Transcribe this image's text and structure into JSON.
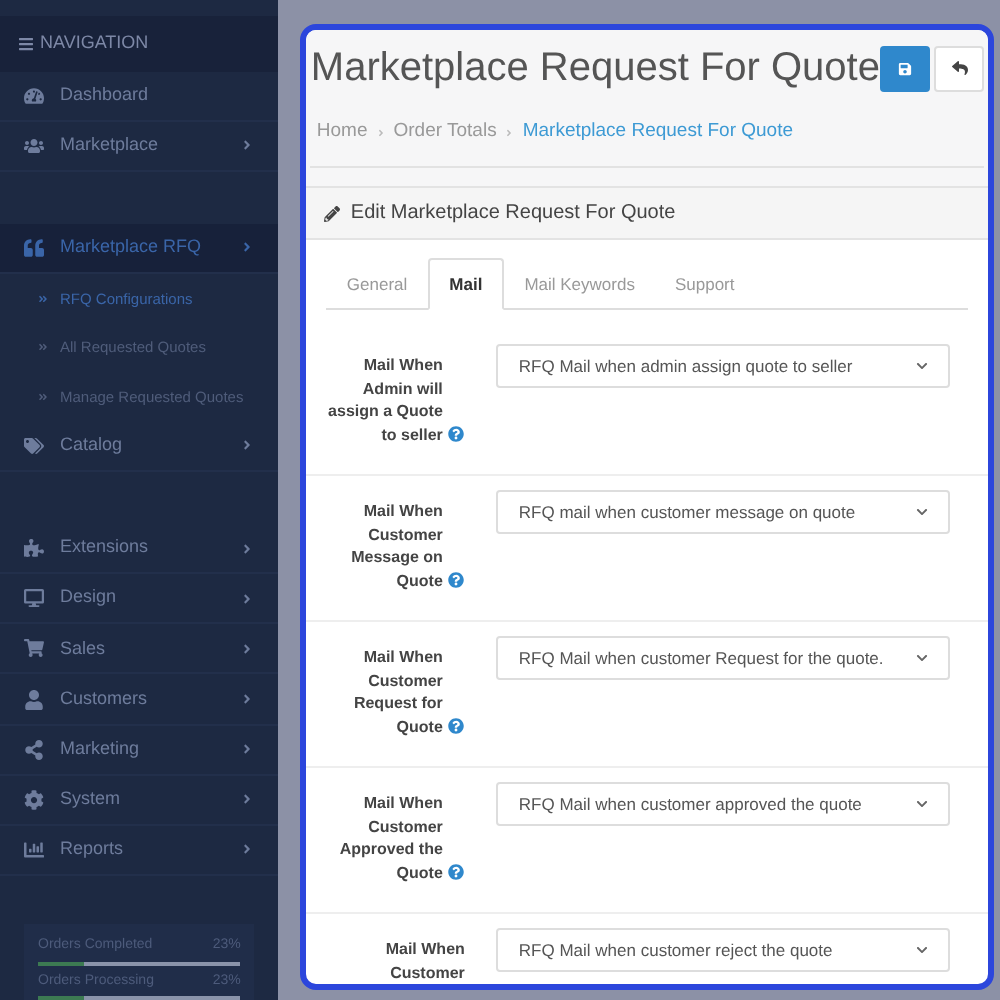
{
  "navigation": {
    "title": "NAVIGATION",
    "items": [
      {
        "label": "Dashboard",
        "expandable": false,
        "selected": false
      },
      {
        "label": "Marketplace",
        "expandable": true,
        "selected": false
      },
      {
        "label": "Marketplace RFQ",
        "expandable": true,
        "selected": true,
        "children": [
          {
            "label": "RFQ Configurations",
            "selected": true
          },
          {
            "label": "All Requested Quotes",
            "selected": false
          },
          {
            "label": "Manage Requested Quotes",
            "selected": false
          }
        ]
      },
      {
        "label": "Catalog",
        "expandable": true,
        "selected": false
      },
      {
        "label": "Extensions",
        "expandable": true,
        "selected": false
      },
      {
        "label": "Design",
        "expandable": true,
        "selected": false
      },
      {
        "label": "Sales",
        "expandable": true,
        "selected": false
      },
      {
        "label": "Customers",
        "expandable": true,
        "selected": false
      },
      {
        "label": "Marketing",
        "expandable": true,
        "selected": false
      },
      {
        "label": "System",
        "expandable": true,
        "selected": false
      },
      {
        "label": "Reports",
        "expandable": true,
        "selected": false
      }
    ],
    "stats": [
      {
        "label": "Orders Completed",
        "value": "23%",
        "level": 0.23
      },
      {
        "label": "Orders Processing",
        "value": "23%",
        "level": 0.23
      }
    ]
  },
  "page": {
    "title": "Marketplace Request For Quote",
    "breadcrumb": [
      {
        "label": "Home",
        "current": false
      },
      {
        "label": "Order Totals",
        "current": false
      },
      {
        "label": "Marketplace Request For Quote",
        "current": true
      }
    ],
    "panel_title": "Edit Marketplace Request For Quote",
    "tabs": [
      {
        "label": "General",
        "selected": false
      },
      {
        "label": "Mail",
        "selected": true
      },
      {
        "label": "Mail Keywords",
        "selected": false
      },
      {
        "label": "Support",
        "selected": false
      }
    ],
    "fields": [
      {
        "label": "Mail When Admin will assign a Quote to seller",
        "value": "RFQ Mail when admin assign quote to seller",
        "help": true
      },
      {
        "label": "Mail When Customer Message on Quote",
        "value": "RFQ mail when customer message on quote",
        "help": true
      },
      {
        "label": "Mail When Customer Request for Quote",
        "value": "RFQ Mail when customer Request for the quote.",
        "help": true
      },
      {
        "label": "Mail When Customer Approved the Quote",
        "value": "RFQ Mail when customer approved the quote",
        "help": true
      },
      {
        "label": "Mail When Customer",
        "value": "RFQ Mail when customer reject the quote",
        "help": false
      }
    ]
  }
}
